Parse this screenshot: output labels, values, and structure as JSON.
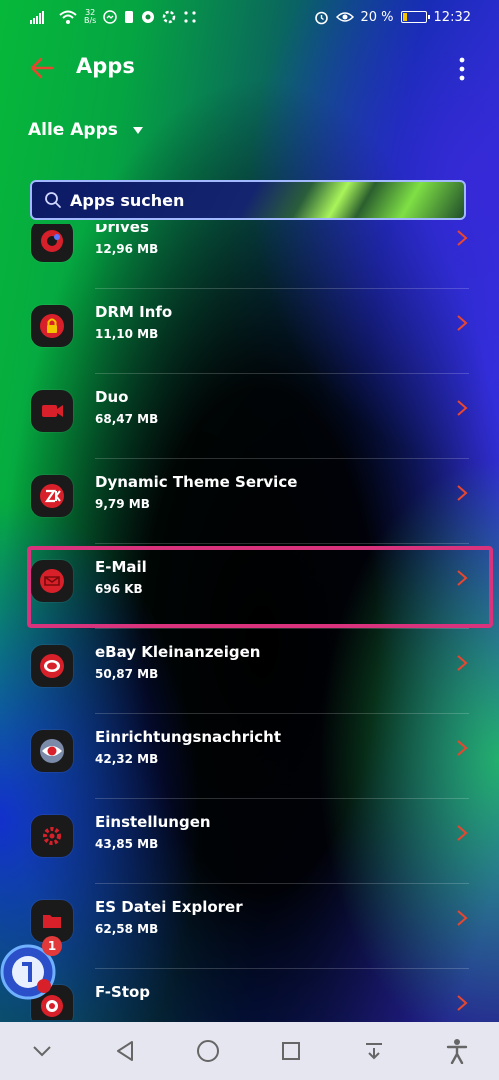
{
  "status_bar": {
    "speed_value": "32",
    "speed_unit": "B/s",
    "battery_percent": "20 %",
    "battery_level": 0.2,
    "time": "12:32"
  },
  "app_bar": {
    "title": "Apps"
  },
  "filter": {
    "label": "Alle Apps"
  },
  "search": {
    "placeholder": "Apps suchen"
  },
  "apps": [
    {
      "name": "Drives",
      "size": "12,96 MB",
      "icon": "drives-icon"
    },
    {
      "name": "DRM Info",
      "size": "11,10 MB",
      "icon": "drm-info-icon"
    },
    {
      "name": "Duo",
      "size": "68,47 MB",
      "icon": "duo-icon"
    },
    {
      "name": "Dynamic Theme Service",
      "size": "9,79 MB",
      "icon": "dynamic-theme-icon"
    },
    {
      "name": "E-Mail",
      "size": "696 KB",
      "icon": "email-icon",
      "highlighted": true
    },
    {
      "name": "eBay Kleinanzeigen",
      "size": "50,87 MB",
      "icon": "ebay-icon"
    },
    {
      "name": "Einrichtungsnachricht",
      "size": "42,32 MB",
      "icon": "setup-message-icon"
    },
    {
      "name": "Einstellungen",
      "size": "43,85 MB",
      "icon": "settings-icon"
    },
    {
      "name": "ES Datei Explorer",
      "size": "62,58 MB",
      "icon": "file-explorer-icon"
    },
    {
      "name": "F-Stop",
      "size": "",
      "icon": "f-stop-icon"
    }
  ],
  "floating_bubble": {
    "badge_count": "1"
  },
  "colors": {
    "accent": "#e8462f",
    "highlight": "#d8337c",
    "icon_red": "#d8202a"
  }
}
